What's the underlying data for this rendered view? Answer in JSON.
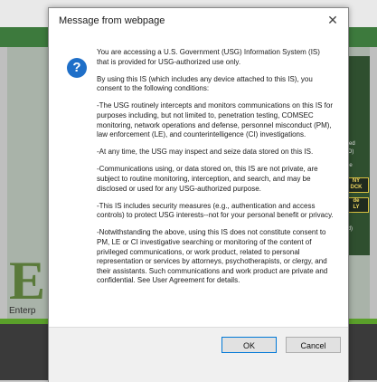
{
  "background": {
    "side_texts": [
      "abled",
      "MIO)",
      "t the"
    ],
    "side_badges": [
      "NY",
      "DCK",
      "de",
      "LY"
    ],
    "side_text_bottom": "ired)",
    "logo_letter": "E",
    "enterp_text": "Enterp"
  },
  "dialog": {
    "title": "Message from webpage",
    "close_symbol": "✕",
    "icon_symbol": "?",
    "paragraphs": [
      "You are accessing a U.S. Government (USG) Information System (IS) that is provided for USG-authorized use only.",
      "By using this IS (which includes any device attached to this IS), you consent to the following conditions:",
      "-The USG routinely intercepts and monitors communications on this IS for purposes including, but not limited to, penetration testing, COMSEC monitoring, network operations and defense, personnel misconduct (PM), law enforcement (LE), and counterintelligence (CI) investigations.",
      "-At any time, the USG may inspect and seize data stored on this IS.",
      "-Communications using, or data stored on, this IS are not private, are subject to routine monitoring, interception, and search, and may be disclosed or used for any USG-authorized purpose.",
      "-This IS includes security measures (e.g., authentication and access controls) to protect USG interests--not for your personal benefit or privacy.",
      "-Notwithstanding the above, using this IS does not constitute consent to PM, LE or CI investigative searching or monitoring of the content of privileged communications, or work product, related to personal representation or services by attorneys, psychotherapists, or clergy, and their assistants. Such communications and work product are private and confidential. See User Agreement for details."
    ],
    "ok_label": "OK",
    "cancel_label": "Cancel"
  }
}
